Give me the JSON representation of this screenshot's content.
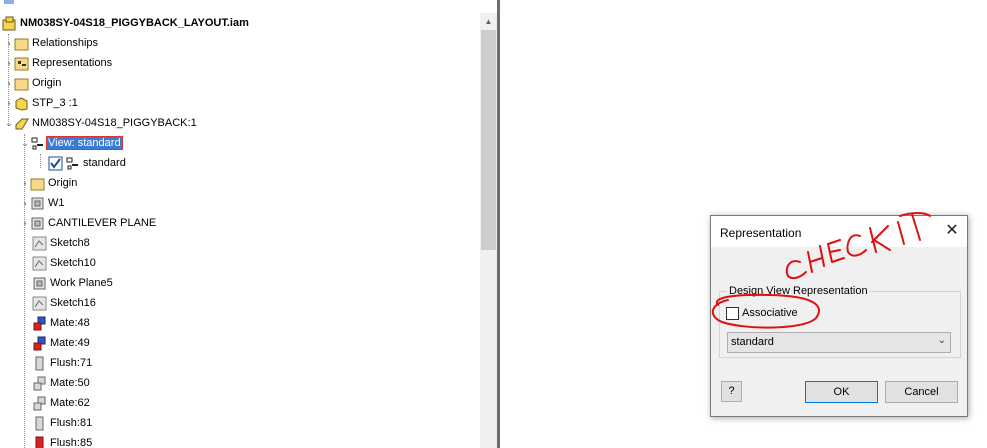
{
  "tree": {
    "root": "NM038SY-04S18_PIGGYBACK_LAYOUT.iam",
    "items": [
      {
        "label": "Relationships"
      },
      {
        "label": "Representations"
      },
      {
        "label": "Origin"
      },
      {
        "label": "STP_3 :1"
      },
      {
        "label": "NM038SY-04S18_PIGGYBACK:1"
      },
      {
        "label": "View: standard"
      },
      {
        "label": "standard"
      },
      {
        "label": "Origin"
      },
      {
        "label": "W1"
      },
      {
        "label": "CANTILEVER PLANE"
      },
      {
        "label": "Sketch8"
      },
      {
        "label": "Sketch10"
      },
      {
        "label": "Work Plane5"
      },
      {
        "label": "Sketch16"
      },
      {
        "label": "Mate:48"
      },
      {
        "label": "Mate:49"
      },
      {
        "label": "Flush:71"
      },
      {
        "label": "Mate:50"
      },
      {
        "label": "Mate:62"
      },
      {
        "label": "Flush:81"
      },
      {
        "label": "Flush:85"
      }
    ]
  },
  "dialog": {
    "title": "Representation",
    "group_label": "Design View Representation",
    "associative_label": "Associative",
    "associative_checked": false,
    "view_select_value": "standard",
    "help_label": "?",
    "ok_label": "OK",
    "cancel_label": "Cancel"
  },
  "annotation": {
    "text": "CHECK IT",
    "color": "#e01010"
  }
}
